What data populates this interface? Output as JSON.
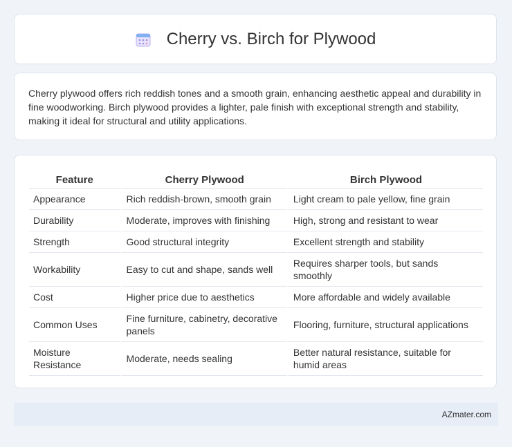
{
  "header": {
    "title": "Cherry vs. Birch for Plywood",
    "icon": "calendar-icon"
  },
  "description": "Cherry plywood offers rich reddish tones and a smooth grain, enhancing aesthetic appeal and durability in fine woodworking. Birch plywood provides a lighter, pale finish with exceptional strength and stability, making it ideal for structural and utility applications.",
  "table": {
    "columns": [
      "Feature",
      "Cherry Plywood",
      "Birch Plywood"
    ],
    "rows": [
      [
        "Appearance",
        "Rich reddish-brown, smooth grain",
        "Light cream to pale yellow, fine grain"
      ],
      [
        "Durability",
        "Moderate, improves with finishing",
        "High, strong and resistant to wear"
      ],
      [
        "Strength",
        "Good structural integrity",
        "Excellent strength and stability"
      ],
      [
        "Workability",
        "Easy to cut and shape, sands well",
        "Requires sharper tools, but sands smoothly"
      ],
      [
        "Cost",
        "Higher price due to aesthetics",
        "More affordable and widely available"
      ],
      [
        "Common Uses",
        "Fine furniture, cabinetry, decorative panels",
        "Flooring, furniture, structural applications"
      ],
      [
        "Moisture Resistance",
        "Moderate, needs sealing",
        "Better natural resistance, suitable for humid areas"
      ]
    ]
  },
  "footer": {
    "brand": "AZmater.com"
  },
  "colors": {
    "background": "#f0f3f8",
    "footer_bg": "#e6edf6",
    "icon_accent": "#8a7ee0"
  }
}
